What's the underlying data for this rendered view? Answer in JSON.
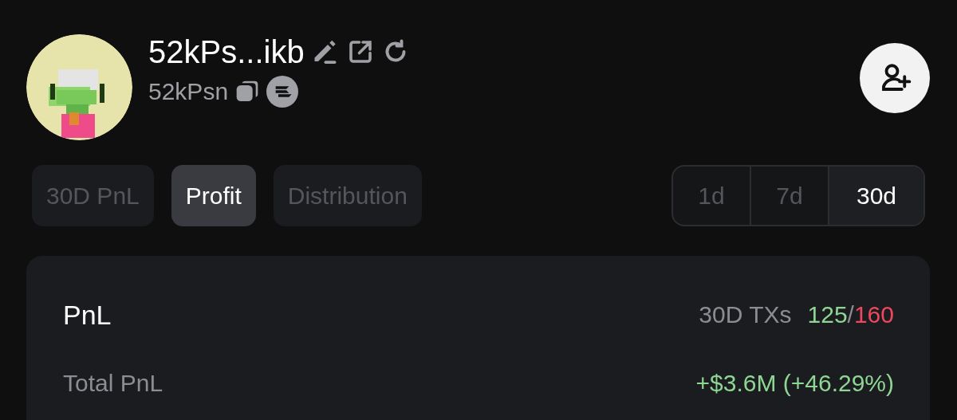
{
  "profile": {
    "name": "52kPs...ikb",
    "handle": "52kPsn"
  },
  "tabs": [
    {
      "label": "30D PnL",
      "selected": false
    },
    {
      "label": "Profit",
      "selected": true
    },
    {
      "label": "Distribution",
      "selected": false
    }
  ],
  "ranges": [
    {
      "label": "1d",
      "selected": false
    },
    {
      "label": "7d",
      "selected": false
    },
    {
      "label": "30d",
      "selected": true
    }
  ],
  "pnl_card": {
    "title": "PnL",
    "txs_label": "30D TXs",
    "wins": "125",
    "separator": "/",
    "losses": "160",
    "rows": [
      {
        "label": "Total PnL",
        "value": "+$3.6M (+46.29%)"
      }
    ]
  }
}
